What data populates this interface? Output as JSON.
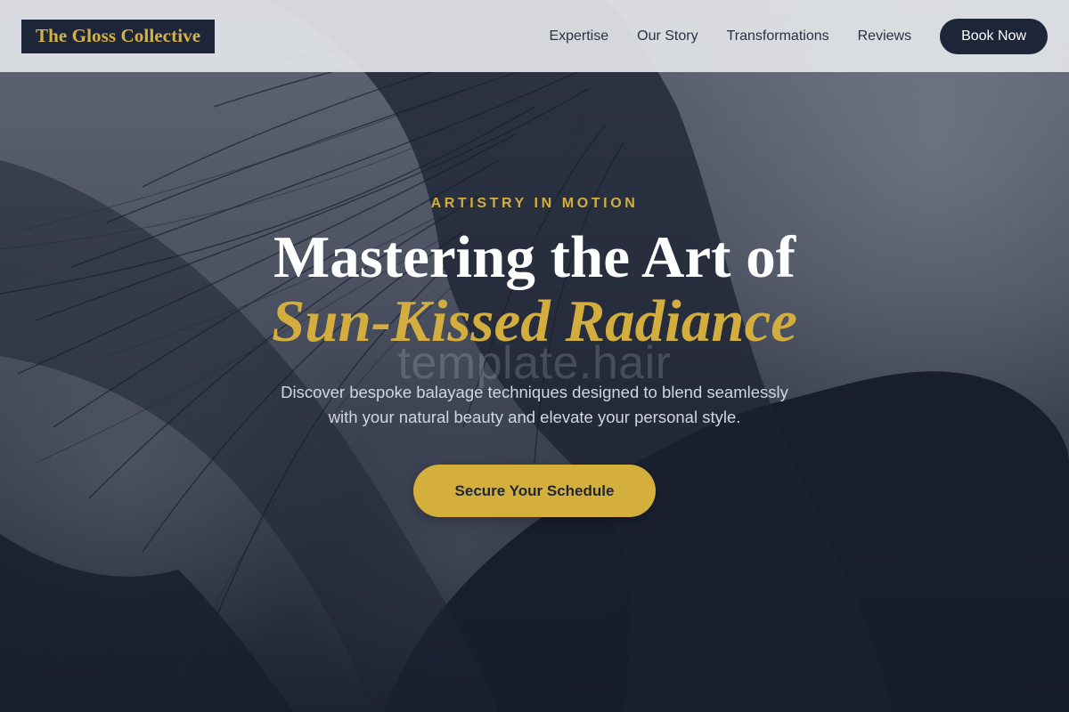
{
  "header": {
    "logo_text": "The Gloss Collective",
    "nav": [
      {
        "label": "Expertise"
      },
      {
        "label": "Our Story"
      },
      {
        "label": "Transformations"
      },
      {
        "label": "Reviews"
      }
    ],
    "book_label": "Book Now"
  },
  "hero": {
    "eyebrow": "ARTISTRY IN MOTION",
    "headline_line1": "Mastering the Art of",
    "headline_line2": "Sun-Kissed Radiance",
    "watermark": "template.hair",
    "subtext": "Discover bespoke balayage techniques designed to blend seamlessly with your natural beauty and elevate your personal style.",
    "cta_label": "Secure Your Schedule",
    "background_image": "woman-with-windswept-dark-hair-photo"
  },
  "colors": {
    "accent_gold": "#d4af3b",
    "navy": "#1c2638",
    "header_bg": "#e2e4e8",
    "white": "#ffffff"
  }
}
